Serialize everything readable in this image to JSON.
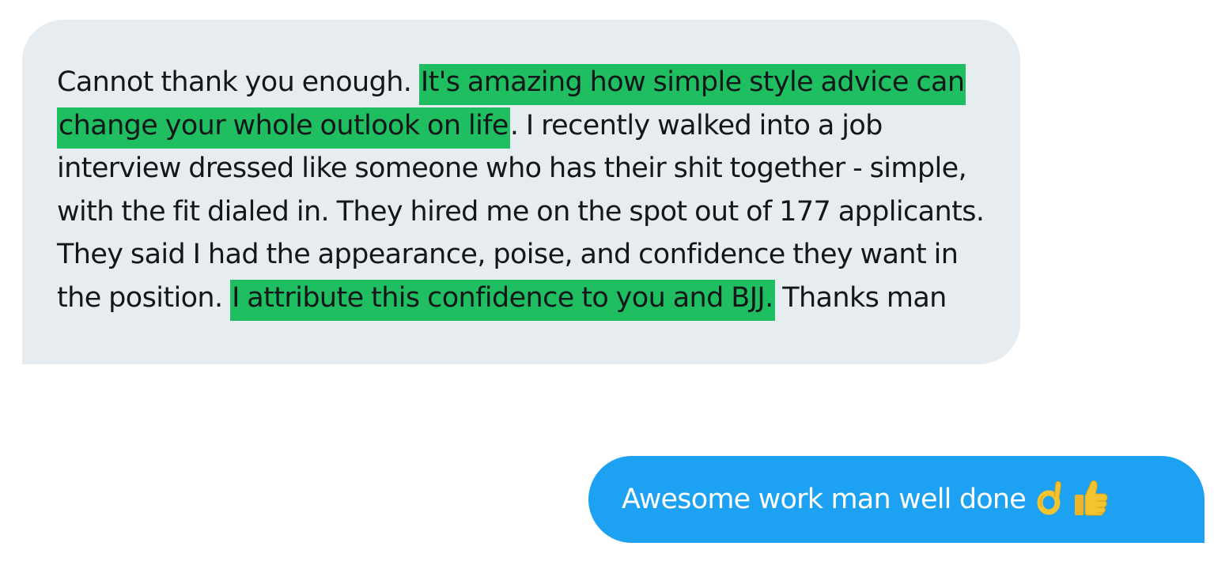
{
  "conversation": {
    "received_message": {
      "segments": [
        {
          "text": "Cannot thank you enough. ",
          "highlighted": false
        },
        {
          "text": "It's amazing how simple style advice can change your whole outlook on life",
          "highlighted": true
        },
        {
          "text": ". I recently walked into a job interview dressed like someone who has their shit together - simple, with the fit dialed in. They hired me on the spot out of 177 applicants. They said I had the appearance, poise, and confidence they want in the position. ",
          "highlighted": false
        },
        {
          "text": "I attribute this confidence to you and BJJ.",
          "highlighted": true
        },
        {
          "text": " Thanks man",
          "highlighted": false
        }
      ]
    },
    "sent_message": {
      "text": "Awesome work man well done",
      "emojis": [
        "ok-hand-icon",
        "thumbs-up-icon"
      ]
    }
  },
  "colors": {
    "received_bubble": "#e6ecf0",
    "sent_bubble": "#1da1f2",
    "highlight": "#1fbf61",
    "text_dark": "#14171a",
    "text_light": "#ffffff",
    "emoji_yellow": "#f4c430"
  }
}
